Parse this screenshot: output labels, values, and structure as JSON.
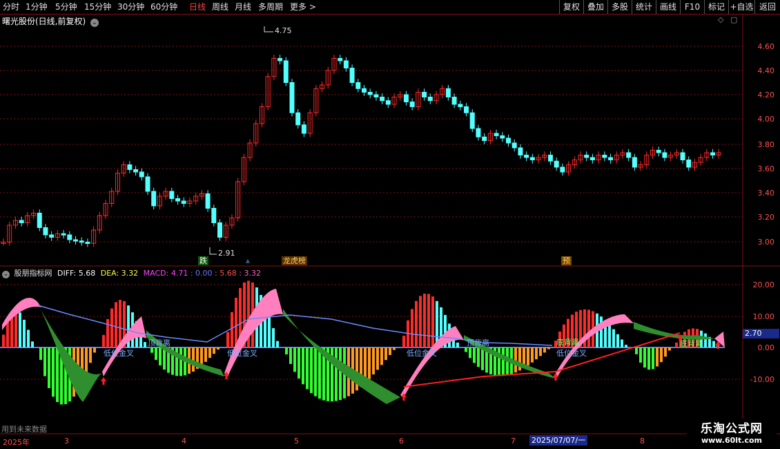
{
  "toolbar": {
    "periods": [
      "分时",
      "1分钟",
      "5分钟",
      "15分钟",
      "30分钟",
      "60分钟",
      "日线",
      "周线",
      "月线",
      "多周期",
      "更多 >"
    ],
    "active_period": "日线",
    "right_buttons": [
      "复权",
      "叠加",
      "多股",
      "统计",
      "画线",
      "F10",
      "标记",
      "+自选",
      "返回"
    ]
  },
  "main_chart": {
    "title": "曙光股份(日线,前复权)",
    "high_label": "4.75",
    "low_label": "2.91",
    "price_ticks": [
      "4.60",
      "4.40",
      "4.20",
      "4.00",
      "3.80",
      "3.60",
      "3.40",
      "3.20",
      "3.00"
    ],
    "badges": {
      "fall": "跌",
      "top_list": "龙虎榜",
      "pre": "预"
    }
  },
  "indicator": {
    "title": "股朋指标网",
    "diff_label": "DIFF: 5.68",
    "dea_label": "DEA: 3.32",
    "macd_label": "MACD: 4.71",
    "extra_values": [
      ": 0.00",
      ": 5.68",
      ": 3.32"
    ],
    "ticks": [
      "20.00",
      "10.00",
      "0.00",
      "-10.00"
    ],
    "current_value": "2.70",
    "signals": {
      "golden_cross": "低位金叉",
      "top_divergence": "顶背离",
      "bottom_divergence": "底背离"
    }
  },
  "footer": {
    "note": "用到未来数据",
    "year": "2025年",
    "months": [
      "3",
      "4",
      "5",
      "6",
      "7",
      "8"
    ],
    "cursor_date": "2025/07/07/一"
  },
  "watermark": {
    "line1": "乐淘公式网",
    "line2": "www.60lt.com"
  },
  "colors": {
    "up": "#ff2a2a",
    "down": "#54ffff",
    "grid": "#8a1010",
    "pink": "#ff7fbf",
    "green_band": "#2f8f2f",
    "dea_line": "#6a8cff"
  }
}
